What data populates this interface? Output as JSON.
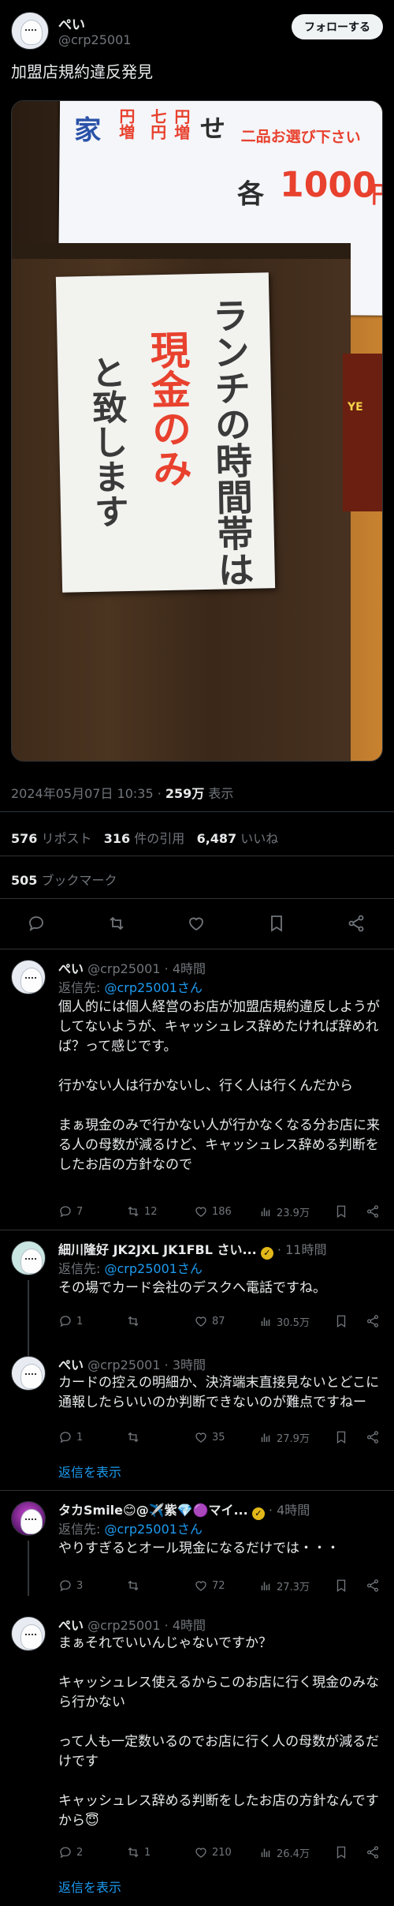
{
  "post": {
    "name": "ぺい",
    "handle": "@crp25001",
    "follow_label": "フォローする",
    "text": "加盟店規約違反発見",
    "photo": {
      "sign_top_lines": [
        "二品お選び下さい",
        "各",
        "1000",
        "円",
        "せ",
        "家",
        "円増",
        "七円",
        "円増"
      ],
      "paper_columns": [
        "ランチの時間帯は",
        "現金のみ",
        "と致します"
      ],
      "side_label": "YE"
    },
    "meta": {
      "datetime": "2024年05月07日 10:35",
      "views_num": "259万",
      "views_label": "表示"
    },
    "stats": {
      "reposts_num": "576",
      "reposts_label": "リポスト",
      "quotes_num": "316",
      "quotes_label": "件の引用",
      "likes_num": "6,487",
      "likes_label": "いいね",
      "bookmarks_num": "505",
      "bookmarks_label": "ブックマーク"
    }
  },
  "replies": [
    {
      "name": "ぺい",
      "handle": "@crp25001",
      "time": "4時間",
      "to_label": "返信先:",
      "to_handle": "@crp25001さん",
      "body": "個人的には個人経営のお店が加盟店規約違反しようがしてないようが、キャッシュレス辞めたければ辞めれば？って感じです。\n\n行かない人は行かないし、行く人は行くんだから\n\nまぁ現金のみで行かない人が行かなくなる分お店に来る人の母数が減るけど、キャッシュレス辞める判断をしたお店の方針なので",
      "replies": "7",
      "reposts": "12",
      "likes": "186",
      "views": "23.9万"
    },
    {
      "name": "細川隆好 JK2JXL JK1FBL さい...",
      "handle": "",
      "time": "11時間",
      "to_label": "返信先:",
      "to_handle": "@crp25001さん",
      "body": "その場でカード会社のデスクへ電話ですね。",
      "replies": "1",
      "reposts": "",
      "likes": "87",
      "views": "30.5万"
    },
    {
      "name": "ぺい",
      "handle": "@crp25001",
      "time": "3時間",
      "to_label": "",
      "to_handle": "",
      "body": "カードの控えの明細か、決済端末直接見ないとどこに通報したらいいのか判断できないのが難点ですねー",
      "replies": "1",
      "reposts": "",
      "likes": "35",
      "views": "27.9万",
      "show_replies": "返信を表示"
    },
    {
      "name": "タカSmile😊@✈️紫💎🟣マイ...",
      "handle": "",
      "time": "4時間",
      "to_label": "返信先:",
      "to_handle": "@crp25001さん",
      "body": "やりすぎるとオール現金になるだけでは・・・",
      "replies": "3",
      "reposts": "",
      "likes": "72",
      "views": "27.3万"
    },
    {
      "name": "ぺい",
      "handle": "@crp25001",
      "time": "4時間",
      "to_label": "",
      "to_handle": "",
      "body": "まぁそれでいいんじゃないですか？\n\nキャッシュレス使えるからこのお店に行く現金のみなら行かない\n\nって人も一定数いるのでお店に行く人の母数が減るだけです\n\nキャッシュレス辞める判断をしたお店の方針なんですから😇",
      "replies": "2",
      "reposts": "1",
      "likes": "210",
      "views": "26.4万",
      "show_replies": "返信を表示"
    }
  ],
  "colors": {
    "accent": "#1d9bf0",
    "background": "#000000",
    "muted": "#71767b",
    "red_text": "#e8412e"
  },
  "icons": [
    "reply-icon",
    "repost-icon",
    "like-icon",
    "bookmark-icon",
    "share-icon",
    "views-icon",
    "verified-badge-icon"
  ]
}
